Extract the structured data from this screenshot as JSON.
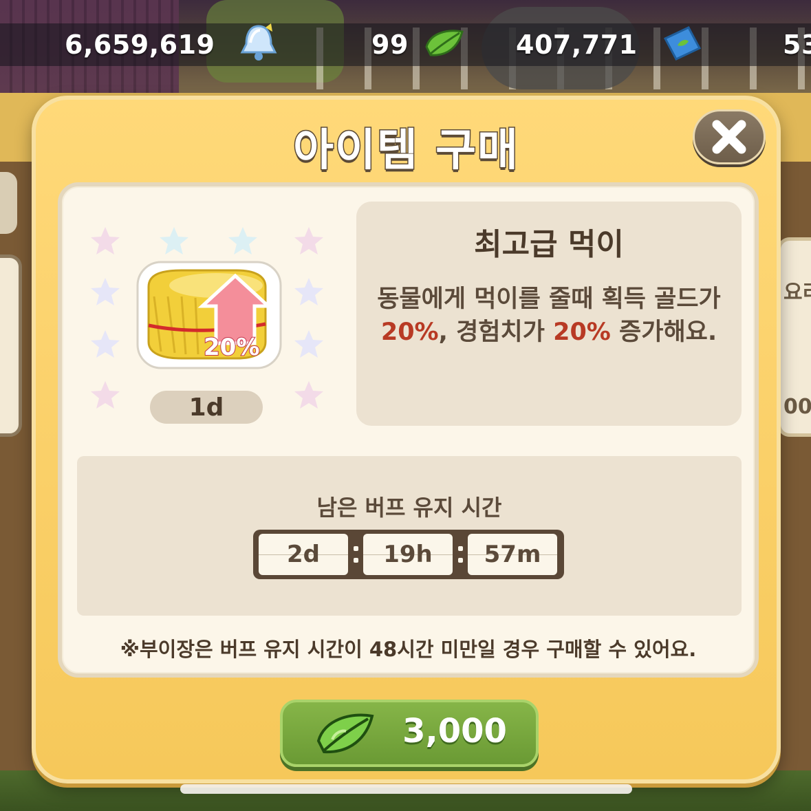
{
  "currency": {
    "bells": "6,659,619",
    "leaves": "99",
    "tickets": "407,771",
    "other_partial": "53"
  },
  "dialog": {
    "title": "아이템 구매",
    "item": {
      "name": "최고급 먹이",
      "badge": "20%",
      "duration": "1d",
      "description_parts": [
        "동물에게 먹이를 줄때 획득 골드가 ",
        "20%",
        ", 경험치가 ",
        "20%",
        " 증가해요."
      ]
    },
    "timer": {
      "label": "남은 버프 유지 시간",
      "days": "2d",
      "hours": "19h",
      "minutes": "57m"
    },
    "note": "※부이장은 버프 유지 시간이 48시간 미만일 경우 구매할 수 있어요.",
    "buy_price": "3,000"
  },
  "background": {
    "right_card_fragment": "요리",
    "right_card_price_fragment": "00"
  },
  "colors": {
    "dialog_bg": "#f6c85a",
    "panel_bg": "#fcf6e9",
    "highlight": "#b83a24",
    "buy_button": "#6a9a34",
    "text_brown": "#4b3a2a"
  }
}
